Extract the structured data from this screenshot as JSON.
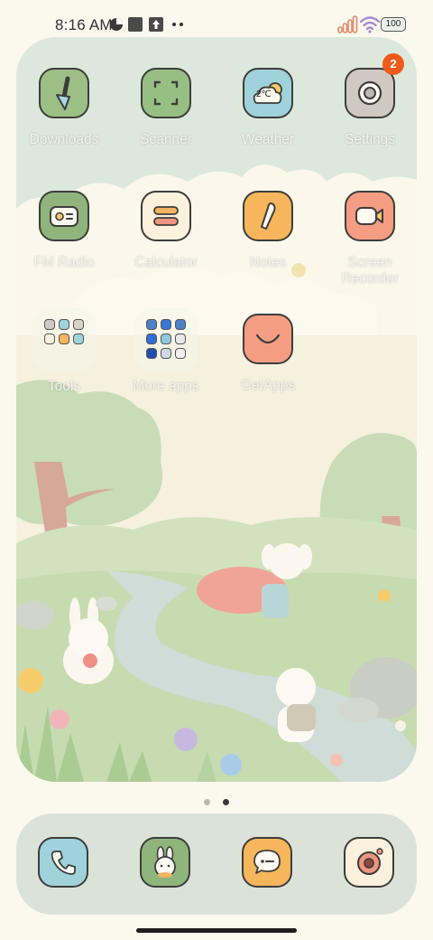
{
  "status_bar": {
    "time": "8:16 AM",
    "battery": "100"
  },
  "apps": [
    {
      "label": "Downloads",
      "icon": "download-brush-icon",
      "color": "#9cbf86"
    },
    {
      "label": "Scanner",
      "icon": "scanner-icon",
      "color": "#97bf84"
    },
    {
      "label": "Weather",
      "icon": "weather-cloud-icon",
      "color": "#9fd2da",
      "icon_text": "2℃"
    },
    {
      "label": "Settings",
      "icon": "settings-gear-icon",
      "color": "#cfc9c1",
      "badge": "2"
    },
    {
      "label": "FM Radio",
      "icon": "radio-icon",
      "color": "#8fb57c"
    },
    {
      "label": "Calculator",
      "icon": "calculator-icon",
      "color": "#fbf1dc"
    },
    {
      "label": "Notes",
      "icon": "notes-pencil-icon",
      "color": "#f7b55c"
    },
    {
      "label": "Screen Recorder",
      "label_line1": "Screen",
      "label_line2": "Recorder",
      "icon": "screen-recorder-icon",
      "color": "#f59d83"
    },
    {
      "label": "GetApps",
      "icon": "getapps-smile-icon",
      "color": "#f59d83"
    }
  ],
  "folders": [
    {
      "label": "Tools"
    },
    {
      "label": "More apps"
    }
  ],
  "page_indicator": {
    "pages": 2,
    "current": 2
  },
  "dock": [
    {
      "name": "phone",
      "icon": "phone-icon",
      "color": "#9fd2da"
    },
    {
      "name": "bunny-app",
      "icon": "bunny-icon",
      "color": "#8fb57c"
    },
    {
      "name": "messages",
      "icon": "message-bubble-icon",
      "color": "#f7b55c"
    },
    {
      "name": "camera",
      "icon": "camera-icon",
      "color": "#fbf1dc"
    }
  ]
}
